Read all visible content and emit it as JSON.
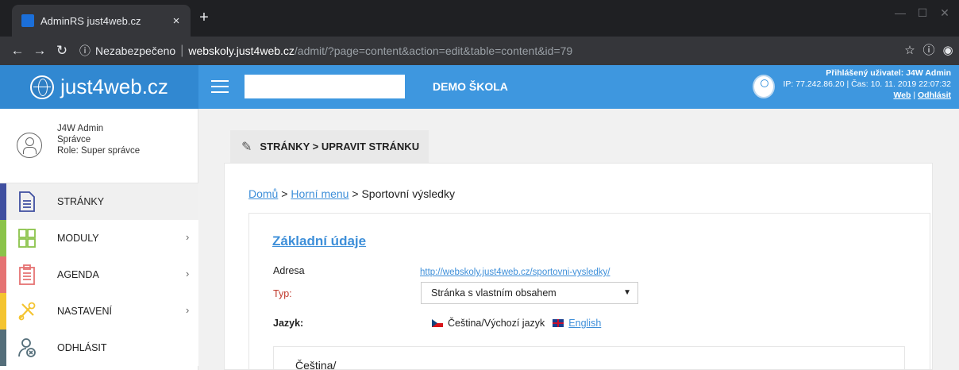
{
  "browser": {
    "tab_title": "AdminRS just4web.cz",
    "tab_close": "×",
    "new_tab": "+",
    "address": {
      "security_label": "Nezabezpečeno",
      "domain": "webskoly.just4web.cz",
      "path": "/admit/?page=content&action=edit&table=content&id=79"
    }
  },
  "header": {
    "logo_text": "just4web.cz",
    "site_name": "DEMO ŠKOLA",
    "search_value": "",
    "user_line": "Přihlášený uživatel: J4W Admin",
    "ip_line": "IP: 77.242.86.20 | Čas: 10. 11. 2019 22:07:32",
    "link_web": "Web",
    "link_separator": " | ",
    "link_logout": "Odhlásit"
  },
  "profile": {
    "name": "J4W Admin",
    "role_title": "Správce",
    "role": "Role: Super správce"
  },
  "sidebar": {
    "items": [
      {
        "label": "STRÁNKY",
        "color": "#3f4fa0",
        "icon": "document-icon",
        "active": true
      },
      {
        "label": "MODULY",
        "color": "#8bc34a",
        "icon": "modules-icon",
        "chevron": "›"
      },
      {
        "label": "AGENDA",
        "color": "#e57373",
        "icon": "clipboard-icon",
        "chevron": "›"
      },
      {
        "label": "NASTAVENÍ",
        "color": "#f4c430",
        "icon": "tools-icon",
        "chevron": "›"
      },
      {
        "label": "ODHLÁSIT",
        "color": "#546e7a",
        "icon": "logout-user-icon"
      }
    ]
  },
  "content": {
    "tab_title": "STRÁNKY > UPRAVIT STRÁNKU",
    "breadcrumb": {
      "home": "Domů",
      "sep1": " > ",
      "menu": "Horní menu",
      "sep2": " > ",
      "current": "Sportovní výsledky"
    },
    "section_title": "Základní údaje",
    "fields": {
      "address_label": "Adresa",
      "address_value": "http://webskoly.just4web.cz/sportovni-vysledky/",
      "type_label": "Typ:",
      "type_value": "Stránka s vlastním obsahem",
      "language_label": "Jazyk:",
      "lang_cz": "Čeština/Výchozí jazyk",
      "lang_en": "English"
    },
    "subsection_title": "Čeština/"
  },
  "colors": {
    "header_blue": "#3e97df",
    "logo_blue": "#3188d1",
    "link_blue": "#3e8fd9"
  }
}
